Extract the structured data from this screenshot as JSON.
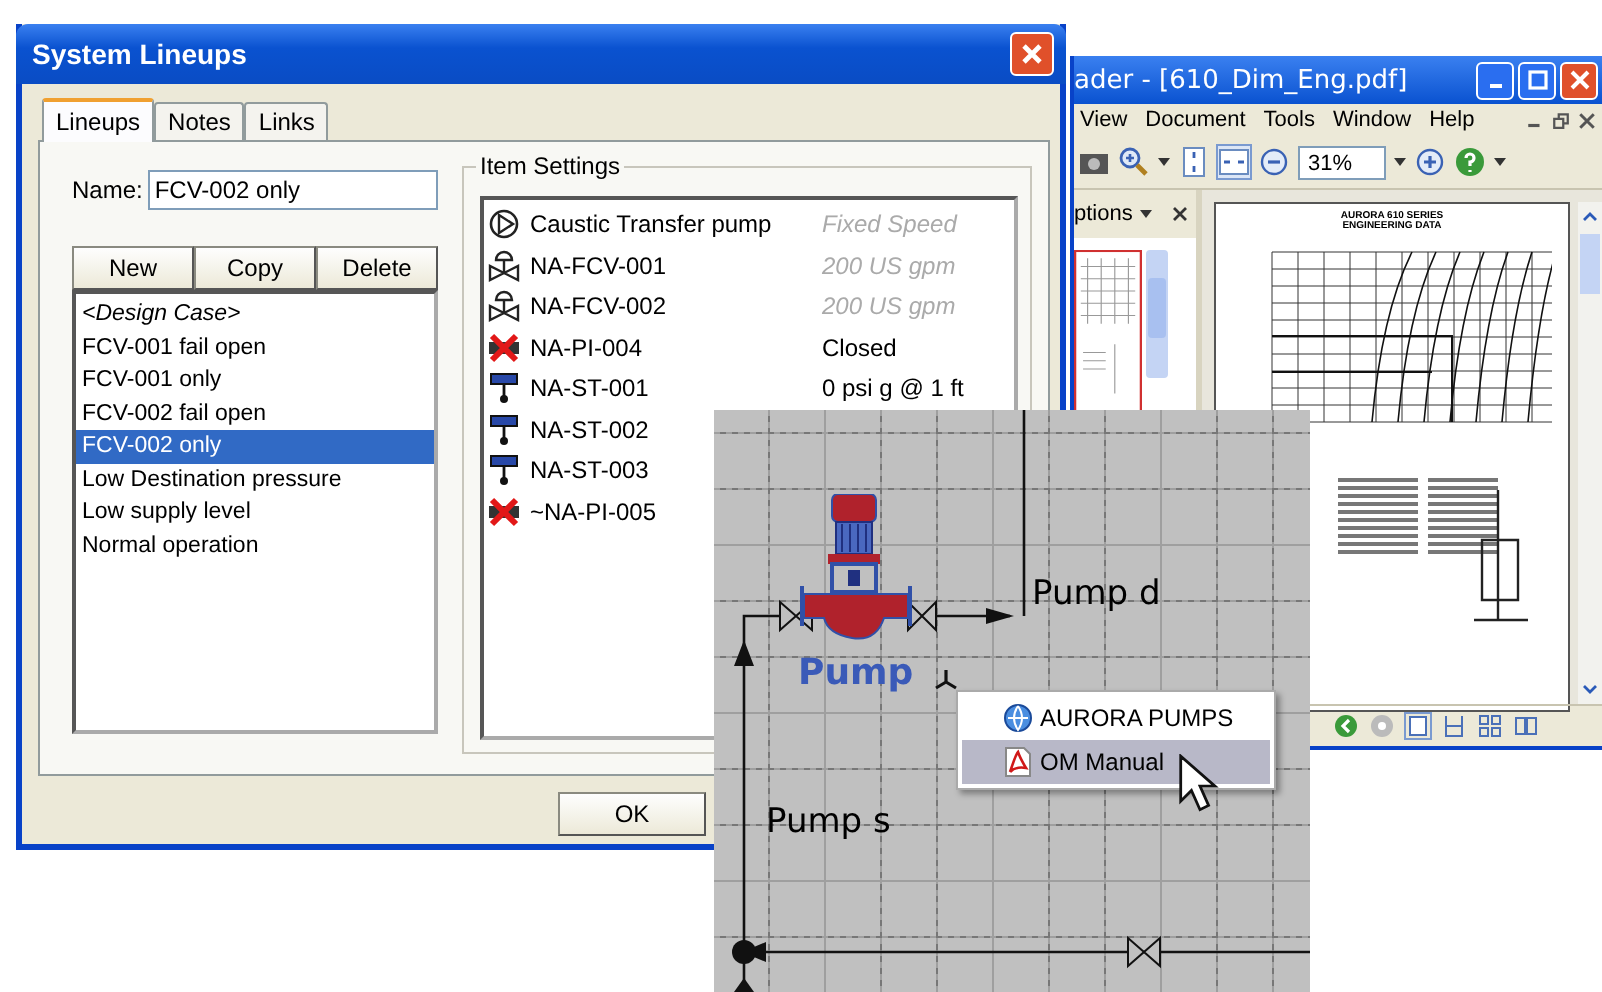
{
  "dialog": {
    "title": "System Lineups",
    "tabs": [
      {
        "label": "Lineups",
        "selected": true
      },
      {
        "label": "Notes",
        "selected": false
      },
      {
        "label": "Links",
        "selected": false
      }
    ],
    "name_label": "Name:",
    "name_value": "FCV-002 only",
    "buttons": [
      "New",
      "Copy",
      "Delete"
    ],
    "lineups": [
      {
        "label": "<Design Case>",
        "kind": "design",
        "selected": false
      },
      {
        "label": "FCV-001 fail open",
        "kind": "case",
        "selected": false
      },
      {
        "label": "FCV-001 only",
        "kind": "case",
        "selected": false
      },
      {
        "label": "FCV-002 fail open",
        "kind": "case",
        "selected": false
      },
      {
        "label": "FCV-002 only",
        "kind": "case",
        "selected": true
      },
      {
        "label": "Low Destination pressure",
        "kind": "case",
        "selected": false
      },
      {
        "label": "Low supply level",
        "kind": "case",
        "selected": false
      },
      {
        "label": "Normal operation",
        "kind": "case",
        "selected": false
      }
    ],
    "item_settings": {
      "title": "Item Settings",
      "items": [
        {
          "kind": "pump",
          "name": "Caustic Transfer pump",
          "value": "Fixed Speed",
          "disabled": true
        },
        {
          "kind": "control_valve",
          "name": "NA-FCV-001",
          "value": "200 US gpm",
          "disabled": true
        },
        {
          "kind": "control_valve",
          "name": "NA-FCV-002",
          "value": "200 US gpm",
          "disabled": true
        },
        {
          "kind": "closed_instrument",
          "name": "NA-PI-004",
          "value": "Closed",
          "disabled": false
        },
        {
          "kind": "tank",
          "name": "NA-ST-001",
          "value": "0 psi g @ 1 ft",
          "disabled": false
        },
        {
          "kind": "tank",
          "name": "NA-ST-002"
        },
        {
          "kind": "tank",
          "name": "NA-ST-003"
        },
        {
          "kind": "closed_instrument",
          "name": "~NA-PI-005"
        }
      ]
    },
    "ok_button": "OK"
  },
  "pdf_reader": {
    "title": "ader - [610_Dim_Eng.pdf]",
    "menu": [
      "View",
      "Document",
      "Tools",
      "Window",
      "Help"
    ],
    "zoom": "31%",
    "panel_title": "ptions",
    "page": {
      "heading": "AURORA 610 SERIES",
      "subheading": "ENGINEERING DATA"
    }
  },
  "diagram": {
    "pump_label": "Pump",
    "discharge_label": "Pump d",
    "suction_label": "Pump s",
    "context_menu": [
      {
        "kind": "web",
        "label": "AURORA PUMPS",
        "selected": false
      },
      {
        "kind": "pdf",
        "label": "OM Manual",
        "selected": true
      }
    ]
  }
}
